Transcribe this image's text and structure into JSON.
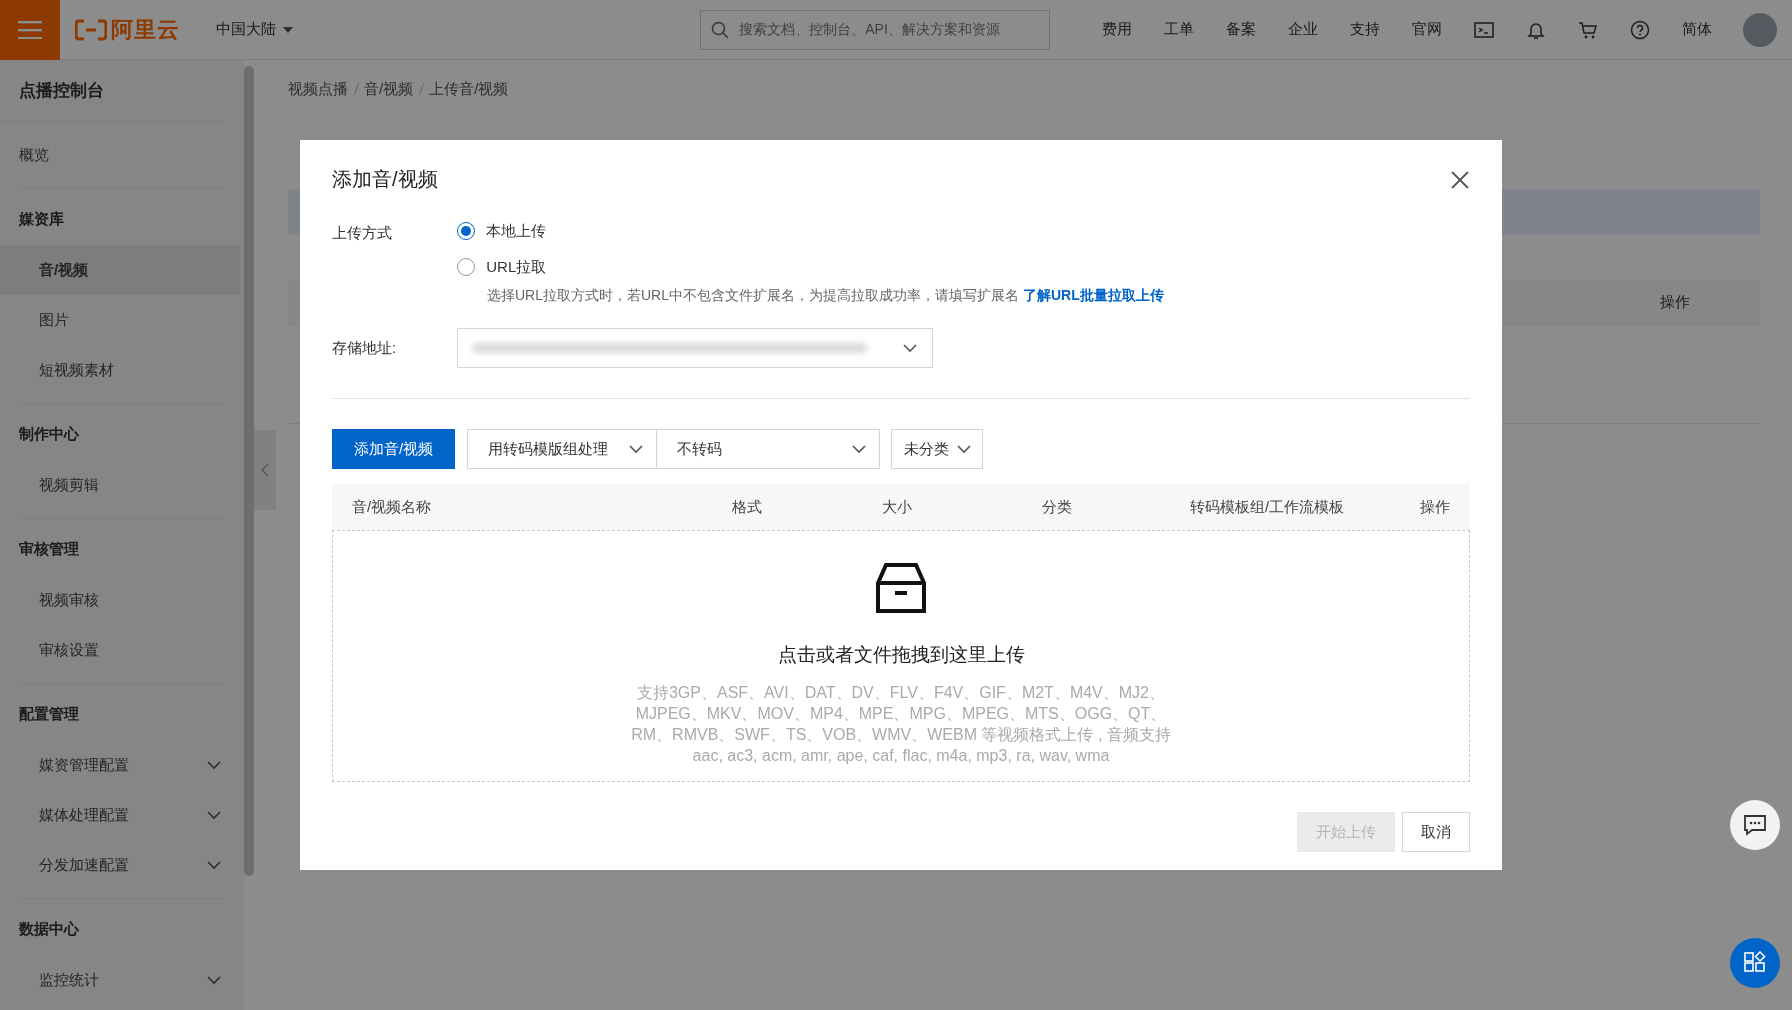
{
  "topbar": {
    "brand": "阿里云",
    "region": "中国大陆",
    "search": {
      "placeholder": "搜索文档、控制台、API、解决方案和资源"
    },
    "links": [
      "费用",
      "工单",
      "备案",
      "企业",
      "支持",
      "官网"
    ],
    "language": "简体"
  },
  "sidebar": {
    "title": "点播控制台",
    "items": [
      {
        "kind": "item",
        "label": "概览",
        "selected": false
      },
      {
        "kind": "group",
        "label": "媒资库",
        "children": [
          {
            "label": "音/视频",
            "selected": true,
            "expandable": false
          },
          {
            "label": "图片",
            "selected": false,
            "expandable": false
          },
          {
            "label": "短视频素材",
            "selected": false,
            "expandable": false
          }
        ]
      },
      {
        "kind": "group",
        "label": "制作中心",
        "children": [
          {
            "label": "视频剪辑",
            "selected": false,
            "expandable": false
          }
        ]
      },
      {
        "kind": "group",
        "label": "审核管理",
        "children": [
          {
            "label": "视频审核",
            "selected": false,
            "expandable": false
          },
          {
            "label": "审核设置",
            "selected": false,
            "expandable": false
          }
        ]
      },
      {
        "kind": "group",
        "label": "配置管理",
        "children": [
          {
            "label": "媒资管理配置",
            "selected": false,
            "expandable": true
          },
          {
            "label": "媒体处理配置",
            "selected": false,
            "expandable": true
          },
          {
            "label": "分发加速配置",
            "selected": false,
            "expandable": true
          }
        ]
      },
      {
        "kind": "group",
        "label": "数据中心",
        "children": [
          {
            "label": "监控统计",
            "selected": false,
            "expandable": true
          }
        ]
      }
    ]
  },
  "breadcrumb": [
    "视频点播",
    "音/视频",
    "上传音/视频"
  ],
  "background_table": {
    "columns": [
      "操作"
    ]
  },
  "dialog": {
    "title": "添加音/视频",
    "upload_method": {
      "label": "上传方式",
      "options": [
        {
          "label": "本地上传",
          "selected": true
        },
        {
          "label": "URL拉取",
          "selected": false
        }
      ],
      "hint": "选择URL拉取方式时，若URL中不包含文件扩展名，为提高拉取成功率，请填写扩展名",
      "hint_link": "了解URL批量拉取上传"
    },
    "storage": {
      "label": "存储地址:"
    },
    "toolbar": {
      "button": "添加音/视频",
      "selects": [
        "用转码模版组处理",
        "不转码",
        "未分类"
      ]
    },
    "table": {
      "columns": [
        "音/视频名称",
        "格式",
        "大小",
        "分类",
        "转码模板组/工作流模板",
        "操作"
      ]
    },
    "dropzone": {
      "title": "点击或者文件拖拽到这里上传",
      "lines": [
        "支持3GP、ASF、AVI、DAT、DV、FLV、F4V、GIF、M2T、M4V、MJ2、",
        "MJPEG、MKV、MOV、MP4、MPE、MPG、MPEG、MTS、OGG、QT、",
        "RM、RMVB、SWF、TS、VOB、WMV、WEBM 等视频格式上传 , 音频支持",
        "aac, ac3, acm, amr, ape, caf, flac, m4a, mp3, ra, wav, wma"
      ]
    },
    "buttons": [
      {
        "label": "开始上传",
        "disabled": true
      },
      {
        "label": "取消",
        "disabled": false
      }
    ]
  }
}
